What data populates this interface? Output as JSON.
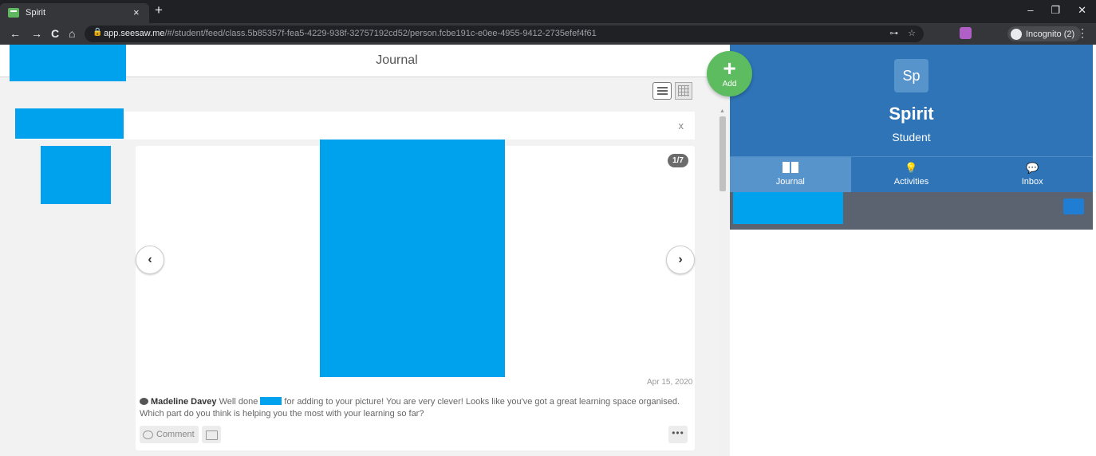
{
  "browser": {
    "tab_title": "Spirit",
    "tab_close": "×",
    "new_tab": "+",
    "url_host": "app.seesaw.me",
    "url_path": "/#/student/feed/class.5b85357f-fea5-4229-938f-32757192cd52/person.fcbe191c-e0ee-4955-9412-2735efef4f61",
    "incognito_label": "Incognito (2)",
    "win_min": "–",
    "win_restore": "❐",
    "win_close": "✕",
    "back": "←",
    "forward": "→",
    "reload": "C",
    "home": "⌂",
    "menu": "⋮",
    "key_icon": "⊶",
    "star_icon": "☆",
    "lock_icon": "🔒"
  },
  "header": {
    "title": "Journal"
  },
  "add_button": {
    "plus": "+",
    "label": "Add"
  },
  "banner": {
    "close": "x"
  },
  "post": {
    "counter": "1/7",
    "prev": "‹",
    "next": "›",
    "date": "Apr 15, 2020",
    "comment_author": "Madeline Davey",
    "comment_part1": " Well done ",
    "comment_part2": " for adding to your picture! You are very clever! Looks like you've got a great learning space organised. Which part do you think is helping you the most with your learning so far?",
    "comment_button": "Comment",
    "more": "•••"
  },
  "profile": {
    "initials": "Sp",
    "name": "Spirit",
    "role": "Student"
  },
  "tabs": [
    {
      "label": "Journal",
      "icon": "book-icon"
    },
    {
      "label": "Activities",
      "icon": "lightbulb-icon"
    },
    {
      "label": "Inbox",
      "icon": "chat-icon"
    }
  ],
  "colors": {
    "brand_blue": "#2e74b7",
    "add_green": "#5cbc5f",
    "redaction": "#00a2ed"
  }
}
